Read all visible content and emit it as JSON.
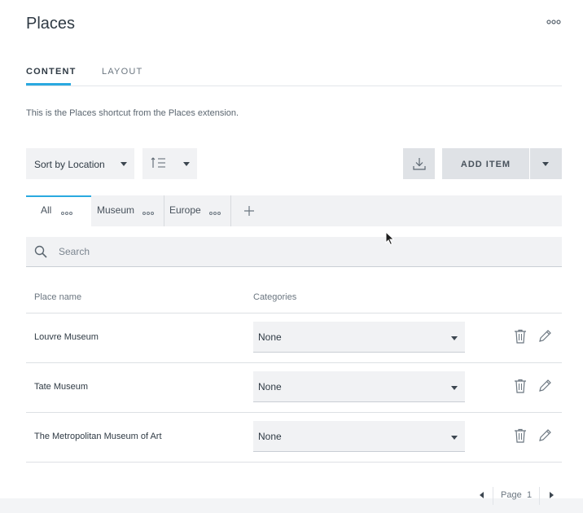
{
  "page": {
    "title": "Places"
  },
  "tabs": [
    {
      "label": "CONTENT",
      "active": true
    },
    {
      "label": "LAYOUT",
      "active": false
    }
  ],
  "description": "This is the Places shortcut from the Places extension.",
  "toolbar": {
    "sort_label": "Sort by Location",
    "order_icon": "sort-order-icon",
    "download_icon": "download-icon",
    "add_item_label": "ADD ITEM"
  },
  "filter_tabs": [
    {
      "label": "All",
      "active": true
    },
    {
      "label": "Museum",
      "active": false
    },
    {
      "label": "Europe",
      "active": false
    }
  ],
  "search": {
    "placeholder": "Search",
    "value": ""
  },
  "table": {
    "columns": [
      "Place name",
      "Categories"
    ],
    "rows": [
      {
        "name": "Louvre Museum",
        "category": "None"
      },
      {
        "name": "Tate Museum",
        "category": "None"
      },
      {
        "name": "The Metropolitan Museum of Art",
        "category": "None"
      }
    ]
  },
  "pagination": {
    "label": "Page",
    "current": "1"
  },
  "colors": {
    "accent": "#2aa9e0",
    "panel": "#f1f2f4",
    "button": "#dfe2e6",
    "text": "#2f3a44"
  }
}
